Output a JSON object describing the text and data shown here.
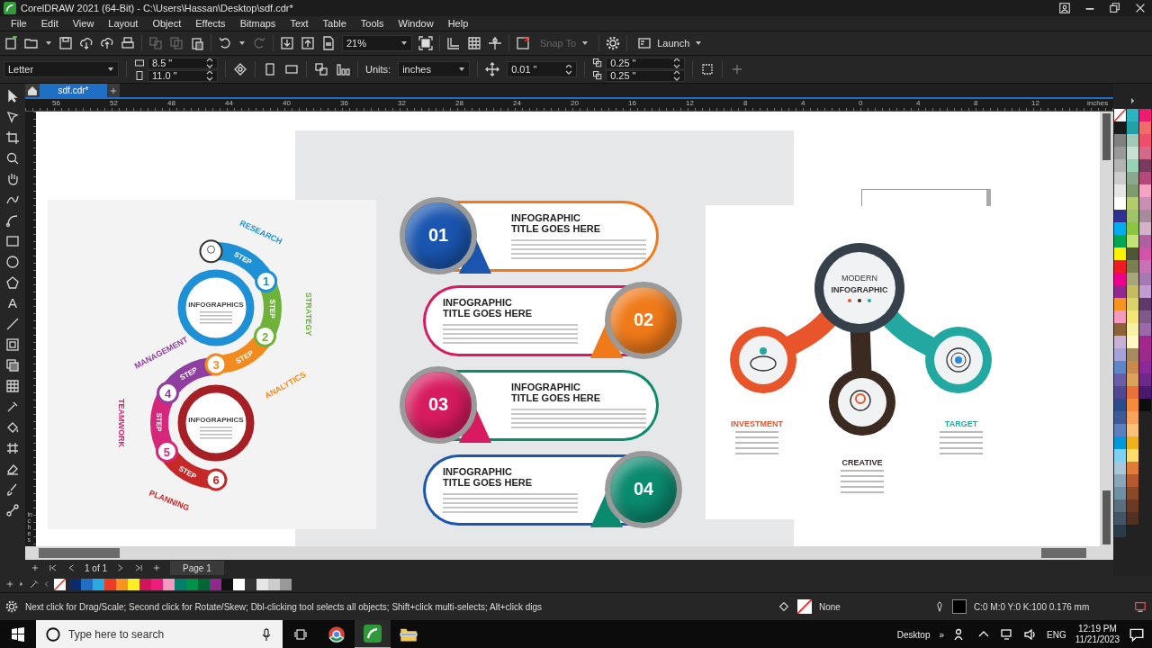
{
  "window": {
    "title": "CorelDRAW 2021 (64-Bit) - C:\\Users\\Hassan\\Desktop\\sdf.cdr*"
  },
  "menu": [
    "File",
    "Edit",
    "View",
    "Layout",
    "Object",
    "Effects",
    "Bitmaps",
    "Text",
    "Table",
    "Tools",
    "Window",
    "Help"
  ],
  "standard_toolbar": {
    "zoom": "21%",
    "snap_to": {
      "label": "Snap To",
      "disabled": true
    },
    "launch": "Launch"
  },
  "property_bar": {
    "page_size": "Letter",
    "width": "8.5 \"",
    "height": "11.0 \"",
    "units_label": "Units:",
    "units": "inches",
    "nudge": "0.01 \"",
    "duplicate_x": "0.25 \"",
    "duplicate_y": "0.25 \""
  },
  "toolbox": {
    "text_tool": "A"
  },
  "document_tabs": [
    {
      "label": "sdf.cdr*",
      "selected": true
    }
  ],
  "ruler": {
    "ticks": [
      "56",
      "52",
      "48",
      "44",
      "40",
      "36",
      "32",
      "28",
      "24",
      "20",
      "16",
      "12",
      "8",
      "4",
      "0",
      "4",
      "8",
      "12"
    ],
    "unit": "inches"
  },
  "vertical_ruler": {
    "unit": "inches"
  },
  "canvas": {
    "spiral": {
      "steps": [
        {
          "number": "1",
          "label": "STEP",
          "category": "RESEARCH",
          "color": "#1e90d6"
        },
        {
          "number": "2",
          "label": "STEP",
          "category": "STRATEGY",
          "color": "#6fb23a"
        },
        {
          "number": "3",
          "label": "STEP",
          "category": "ANALYTICS",
          "color": "#f28a1e"
        },
        {
          "number": "4",
          "label": "STEP",
          "category": "MANAGEMENT",
          "color": "#8e3fa0"
        },
        {
          "number": "5",
          "label": "STEP",
          "category": "TEAMWORK",
          "color": "#d6287a"
        },
        {
          "number": "6",
          "label": "STEP",
          "category": "PLANNING",
          "color": "#c62828"
        }
      ],
      "circles": [
        {
          "heading": "INFOGRAPHICS",
          "color": "#1e90d6"
        },
        {
          "heading": "INFOGRAPHICS",
          "color": "#a51f24"
        }
      ]
    },
    "steps_list": [
      {
        "number": "01",
        "title": "INFOGRAPHIC TITLE GOES HERE",
        "color": "#1a56b0"
      },
      {
        "number": "02",
        "title": "INFOGRAPHIC TITLE GOES HERE",
        "color": "#f07a1a"
      },
      {
        "number": "03",
        "title": "INFOGRAPHIC TITLE GOES HERE",
        "color": "#d81b60"
      },
      {
        "number": "04",
        "title": "INFOGRAPHIC TITLE GOES HERE",
        "color": "#0a8a6e"
      }
    ],
    "mind_map": {
      "heading": [
        "MODERN",
        "INFOGRAPHIC"
      ],
      "branches": [
        {
          "label": "INVESTMENT",
          "color": "#e8552a"
        },
        {
          "label": "CREATIVE",
          "color": "#3b2a20"
        },
        {
          "label": "TARGET",
          "color": "#22a8a0"
        }
      ]
    }
  },
  "page_nav": {
    "counter": "1 of 1",
    "pages": [
      {
        "label": "Page 1",
        "selected": true
      }
    ]
  },
  "document_palette": [
    {
      "color": "#0d2a6b"
    },
    {
      "color": "#1f6fc5"
    },
    {
      "color": "#29abe2"
    },
    {
      "color": "#ed3b24"
    },
    {
      "color": "#f7931e"
    },
    {
      "color": "#fcee21"
    },
    {
      "color": "#d4145a"
    },
    {
      "color": "#ed1e79"
    },
    {
      "color": "#f49ac1"
    },
    {
      "color": "#00806a"
    },
    {
      "color": "#009245"
    },
    {
      "color": "#006837"
    },
    {
      "color": "#93278f"
    },
    {
      "color": "#111111"
    },
    {
      "color": "#ffffff"
    },
    {
      "color": "#333333"
    },
    {
      "color": "#e6e6e6"
    },
    {
      "color": "#cccccc"
    },
    {
      "color": "#999999"
    }
  ],
  "color_palette": [
    {
      "swatches": [
        {
          "color": "#1a1a1a"
        },
        {
          "color": "#808080"
        },
        {
          "color": "#999999"
        },
        {
          "color": "#b3b3b3"
        },
        {
          "color": "#cccccc"
        },
        {
          "color": "#e6e6e6"
        },
        {
          "color": "#ffffff"
        },
        {
          "color": "#2e3192"
        },
        {
          "color": "#00aeef"
        },
        {
          "color": "#00a651"
        },
        {
          "color": "#fff200"
        },
        {
          "color": "#ed1c24"
        },
        {
          "color": "#ec008c"
        },
        {
          "color": "#92278f"
        },
        {
          "color": "#f7941d"
        },
        {
          "color": "#f49ac1"
        },
        {
          "color": "#8c6239"
        },
        {
          "color": "#c7b2d6"
        },
        {
          "color": "#a3a3d8"
        },
        {
          "color": "#5f86c9"
        },
        {
          "color": "#6b5ea8"
        },
        {
          "color": "#4f4a8f"
        },
        {
          "color": "#2b4c8c"
        },
        {
          "color": "#3e5b98"
        },
        {
          "color": "#5c7fbf"
        },
        {
          "color": "#0098d8"
        },
        {
          "color": "#7fd0f2"
        },
        {
          "color": "#a9c7d8"
        },
        {
          "color": "#8aa6b8"
        },
        {
          "color": "#6f8fa3"
        },
        {
          "color": "#596f7e"
        },
        {
          "color": "#445566"
        },
        {
          "color": "#2b3a47"
        }
      ]
    },
    {
      "swatches": [
        {
          "color": "#2bb3c0"
        },
        {
          "color": "#26a0a8"
        },
        {
          "color": "#a1c9b5"
        },
        {
          "color": "#c6e2d2"
        },
        {
          "color": "#98d2b4"
        },
        {
          "color": "#8ca88c"
        },
        {
          "color": "#7f9a6b"
        },
        {
          "color": "#b3cc6b"
        },
        {
          "color": "#9fc46b"
        },
        {
          "color": "#8cc63f"
        },
        {
          "color": "#c5e17a"
        },
        {
          "color": "#4d5736"
        },
        {
          "color": "#7a8050"
        },
        {
          "color": "#a6a67a"
        },
        {
          "color": "#c4bc5e"
        },
        {
          "color": "#d9d36a"
        },
        {
          "color": "#f0e67a"
        },
        {
          "color": "#f7f0a5"
        },
        {
          "color": "#fff7c4"
        },
        {
          "color": "#a58a5e"
        },
        {
          "color": "#c98a4b"
        },
        {
          "color": "#d9a35c"
        },
        {
          "color": "#e8733a"
        },
        {
          "color": "#f68b3c"
        },
        {
          "color": "#f9a45c"
        },
        {
          "color": "#fbc37a"
        },
        {
          "color": "#f0b21a"
        },
        {
          "color": "#fddc6b"
        },
        {
          "color": "#e07b39"
        },
        {
          "color": "#b55a2e"
        },
        {
          "color": "#8a4a2a"
        },
        {
          "color": "#6b3a25"
        },
        {
          "color": "#503020"
        }
      ]
    },
    {
      "swatches": [
        {
          "color": "#ed1c70"
        },
        {
          "color": "#f26c6c"
        },
        {
          "color": "#ee4d6b"
        },
        {
          "color": "#d46a8a"
        },
        {
          "color": "#7a3a5e"
        },
        {
          "color": "#b34a7a"
        },
        {
          "color": "#f4a3c5"
        },
        {
          "color": "#c98fb3"
        },
        {
          "color": "#a78a9c"
        },
        {
          "color": "#d4b3c8"
        },
        {
          "color": "#b05fa3"
        },
        {
          "color": "#d154a8"
        },
        {
          "color": "#c873b8"
        },
        {
          "color": "#a779b3"
        },
        {
          "color": "#c39bd3"
        },
        {
          "color": "#5e3a6b"
        },
        {
          "color": "#7e5a8a"
        },
        {
          "color": "#9a6aa8"
        },
        {
          "color": "#a0288c"
        },
        {
          "color": "#9b2a8a"
        },
        {
          "color": "#8a2a9a"
        },
        {
          "color": "#6b2a8a"
        },
        {
          "color": "#4a1a6a"
        },
        {
          "color": "#0d0d0d"
        }
      ]
    }
  ],
  "status_bar": {
    "hint": "Next click for Drag/Scale; Second click for Rotate/Skew; Dbl-clicking tool selects all objects; Shift+click multi-selects; Alt+click digs",
    "fill": "None",
    "outline": "C:0 M:0 Y:0 K:100  0.176 mm"
  },
  "taskbar": {
    "search_placeholder": "Type here to search",
    "desktop": "Desktop",
    "chevron": "»",
    "language": "ENG",
    "time": "12:19 PM",
    "date": "11/21/2023"
  }
}
